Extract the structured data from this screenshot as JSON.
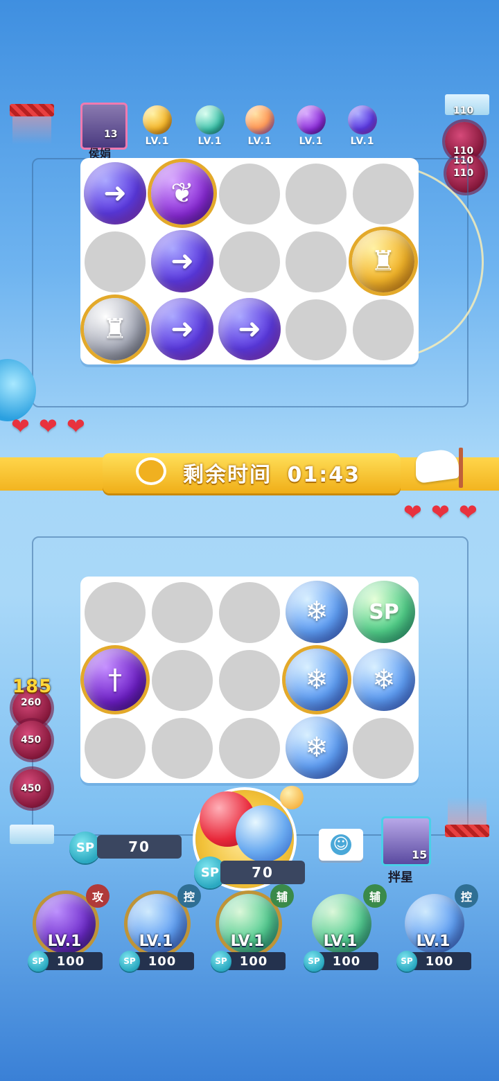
{
  "opponent": {
    "name": "侯娟",
    "avatar_level": "13",
    "deck_levels": [
      "LV.1",
      "LV.1",
      "LV.1",
      "LV.1",
      "LV.1"
    ],
    "enemy_hp": [
      "110",
      "110",
      "110",
      "110"
    ],
    "hearts": 3
  },
  "timer": {
    "label": "剩余时间",
    "value": "01:43"
  },
  "player": {
    "name": "拌星",
    "avatar_level": "15",
    "hearts": 3,
    "sp_label": "SP",
    "sp_value": "70",
    "summon_sp_value": "70",
    "enemy_wave": "185",
    "enemy_hp": [
      "260",
      "450",
      "450"
    ],
    "deck": [
      {
        "level": "LV.1",
        "tag": "攻",
        "cost": "100",
        "cost_label": "SP"
      },
      {
        "level": "LV.1",
        "tag": "控",
        "cost": "100",
        "cost_label": "SP"
      },
      {
        "level": "LV.1",
        "tag": "辅",
        "cost": "100",
        "cost_label": "SP"
      },
      {
        "level": "LV.1",
        "tag": "辅",
        "cost": "100",
        "cost_label": "SP"
      },
      {
        "level": "LV.1",
        "tag": "控",
        "cost": "100",
        "cost_label": "SP"
      }
    ]
  },
  "icons": {
    "emote": "smile-icon",
    "flag": "white-flag-icon",
    "timer_emblem": "crest-icon"
  },
  "colors": {
    "banner": "#f2b420",
    "heart": "#e8323e",
    "sp_badge": "#2aa8c0"
  }
}
